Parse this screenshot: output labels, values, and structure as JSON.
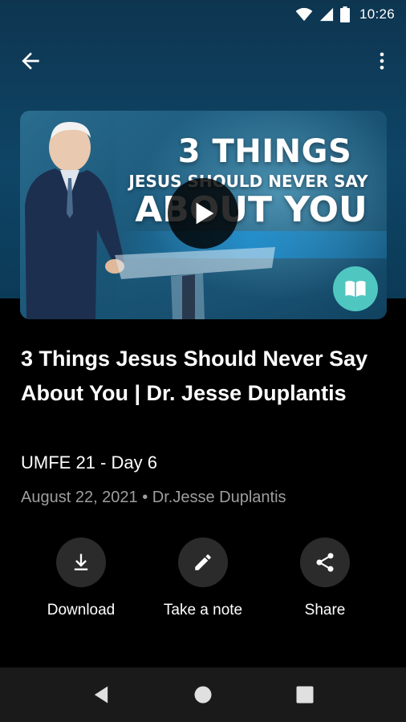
{
  "status_bar": {
    "time": "10:26"
  },
  "video": {
    "thumbnail_line1": "3 THINGS",
    "thumbnail_line2": "JESUS SHOULD NEVER SAY",
    "thumbnail_line3": "ABOUT YOU"
  },
  "sermon": {
    "title": "3 Things Jesus Should Never Say About You | Dr. Jesse Duplantis",
    "series": "UMFE 21 - Day 6",
    "meta": "August 22, 2021 • Dr.Jesse Duplantis"
  },
  "actions": {
    "download_label": "Download",
    "note_label": "Take a note",
    "share_label": "Share"
  },
  "colors": {
    "hero_background": "#0f4566",
    "accent_teal": "#4fc7c0",
    "action_circle": "#2b2b2b",
    "meta_text": "#9e9e9e"
  },
  "icons": [
    "wifi-icon",
    "signal-icon",
    "battery-icon",
    "back-arrow-icon",
    "more-vert-icon",
    "play-icon",
    "book-icon",
    "download-icon",
    "pencil-icon",
    "share-icon",
    "nav-back-icon",
    "nav-home-icon",
    "nav-recents-icon"
  ]
}
